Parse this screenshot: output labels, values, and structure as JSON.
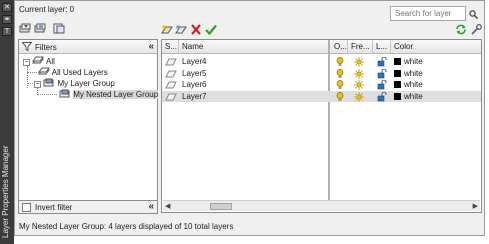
{
  "palette": {
    "title": "Layer Properties Manager",
    "close_glyph": "✕",
    "autohide_glyph": "◂▸",
    "props_glyph": "T"
  },
  "header": {
    "current_layer": "Current layer: 0",
    "search_placeholder": "Search for layer"
  },
  "tree": {
    "header_label": "Filters",
    "collapse_glyph": "«",
    "items": [
      {
        "label": "All",
        "expand": "−"
      },
      {
        "label": "All Used Layers"
      },
      {
        "label": "My Layer Group",
        "expand": "−"
      },
      {
        "label": "My Nested Layer Group"
      }
    ],
    "invert_filter_label": "Invert filter",
    "invert_filter_checked": false
  },
  "grid": {
    "columns": [
      {
        "label": "S..."
      },
      {
        "label": "Name"
      },
      {
        "label": "O..."
      },
      {
        "label": "Fre..."
      },
      {
        "label": "L..."
      },
      {
        "label": "Color"
      }
    ],
    "rows": [
      {
        "name": "Layer4",
        "color_name": "white",
        "color": "#000000"
      },
      {
        "name": "Layer5",
        "color_name": "white",
        "color": "#000000"
      },
      {
        "name": "Layer6",
        "color_name": "white",
        "color": "#000000"
      },
      {
        "name": "Layer7",
        "color_name": "white",
        "color": "#000000"
      }
    ],
    "selected_row": 3
  },
  "status": {
    "text": "My Nested Layer Group: 4 layers displayed of 10 total layers"
  },
  "colors": {
    "accent_green": "#2f9e2f",
    "delete_red": "#d02020",
    "bulb_yellow": "#f2c200",
    "lock_blue": "#2f6fbf"
  }
}
